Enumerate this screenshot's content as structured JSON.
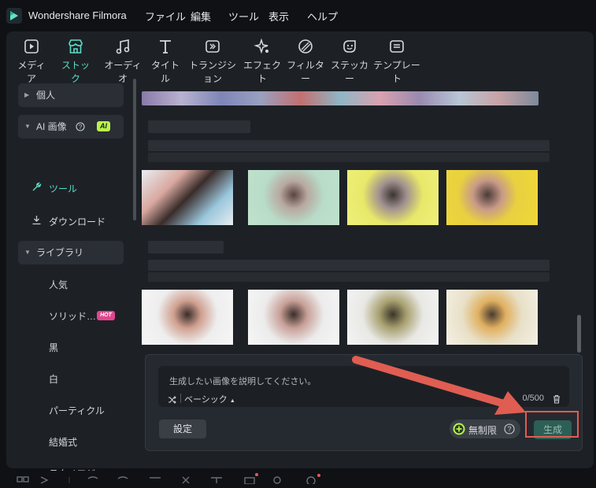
{
  "app": {
    "title": "Wondershare Filmora"
  },
  "menu": [
    "ファイル",
    "編集",
    "ツール",
    "表示",
    "ヘルプ"
  ],
  "tabs": [
    {
      "label": "メディア",
      "icon": "media-icon"
    },
    {
      "label": "ストック",
      "icon": "stock-icon",
      "active": true
    },
    {
      "label": "オーディオ",
      "icon": "music-note-icon"
    },
    {
      "label": "タイトル",
      "icon": "title-t-icon"
    },
    {
      "label": "トランジション",
      "icon": "transition-icon"
    },
    {
      "label": "エフェクト",
      "icon": "effect-sparkle-icon"
    },
    {
      "label": "フィルター",
      "icon": "filter-icon"
    },
    {
      "label": "ステッカー",
      "icon": "sticker-icon"
    },
    {
      "label": "テンプレート",
      "icon": "template-icon"
    }
  ],
  "sidebar": {
    "personal": "個人",
    "ai_image": "AI 画像",
    "ai_badge": "AI",
    "tool": "ツール",
    "download": "ダウンロード",
    "library": "ライブラリ",
    "items": [
      "人気",
      "ソリッド…",
      "黒",
      "白",
      "パーティクル",
      "結婚式",
      "テクノロジー"
    ],
    "hot_badge": "HOT"
  },
  "generator": {
    "placeholder": "生成したい画像を説明してください。",
    "mode": "ベーシック",
    "count": "0/500",
    "settings_label": "設定",
    "unlimited_label": "無制限",
    "generate_label": "生成"
  },
  "colors": {
    "accent": "#59dfc7",
    "highlight": "#e05d52",
    "hot": "#e2458f",
    "ai_badge": "#b9f24b"
  }
}
